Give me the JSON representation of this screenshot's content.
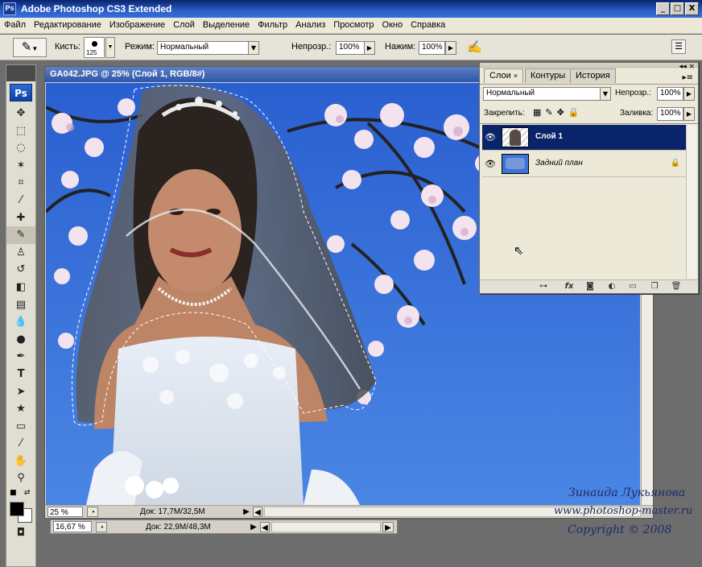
{
  "app": {
    "title": "Adobe Photoshop CS3 Extended",
    "badge": "Ps",
    "window_buttons": {
      "minimize": "_",
      "maximize": "□",
      "close": "X"
    }
  },
  "menu": [
    "Файл",
    "Редактирование",
    "Изображение",
    "Слой",
    "Выделение",
    "Фильтр",
    "Анализ",
    "Просмотр",
    "Окно",
    "Справка"
  ],
  "options_bar": {
    "brush_label": "Кисть:",
    "brush_size": "125",
    "mode_label": "Режим:",
    "mode_value": "Нормальный",
    "opacity_label": "Непрозр.:",
    "opacity_value": "100%",
    "pressure_label": "Нажим:",
    "pressure_value": "100%"
  },
  "tools": {
    "ps_logo": "Ps",
    "items": [
      "move-icon",
      "marquee-icon",
      "lasso-icon",
      "magic-wand-icon",
      "crop-icon",
      "eyedropper-icon",
      "healing-icon",
      "brush-icon",
      "stamp-icon",
      "history-brush-icon",
      "eraser-icon",
      "gradient-icon",
      "blur-icon",
      "dodge-icon",
      "pen-icon",
      "type-icon",
      "path-select-icon",
      "shape-icon",
      "notes-icon",
      "eyedropper2-icon",
      "hand-icon",
      "zoom-icon"
    ],
    "selected_index": 7
  },
  "document": {
    "title": "GA042.JPG @ 25% (Слой 1, RGB/8#)",
    "zoom": "25 %",
    "doc_info": "Док: 17,7M/32,5M"
  },
  "background_doc": {
    "zoom": "16,67 %",
    "doc_info": "Док: 22,9M/48,3M"
  },
  "layers_panel": {
    "tabs": [
      "Слои",
      "Контуры",
      "История"
    ],
    "active_tab": 0,
    "blend_mode": "Нормальный",
    "opacity_label": "Непрозр.:",
    "opacity_value": "100%",
    "lock_label": "Закрепить:",
    "fill_label": "Заливка:",
    "fill_value": "100%",
    "layers": [
      {
        "name": "Слой 1",
        "selected": true,
        "visible": true
      },
      {
        "name": "Задний план",
        "selected": false,
        "visible": true,
        "locked": true
      }
    ],
    "footer_icons": [
      "link-icon",
      "fx-icon",
      "mask-icon",
      "adjustment-icon",
      "folder-icon",
      "new-layer-icon",
      "trash-icon"
    ]
  },
  "watermark": {
    "author": "Зинаида Лукьянова",
    "site": "www.photoshop-master.ru",
    "copyright": "Copyright © 2008"
  },
  "colors": {
    "title_bar": "#0a246a",
    "selection": "#0a246a",
    "sky": "#3f7cdd"
  }
}
